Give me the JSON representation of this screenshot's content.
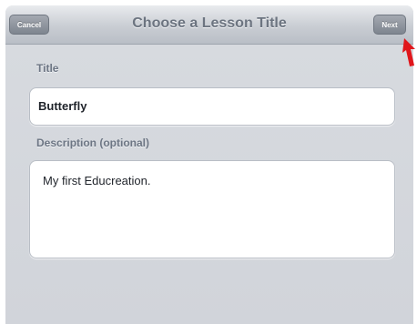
{
  "nav": {
    "title": "Choose a Lesson Title",
    "cancel_label": "Cancel",
    "next_label": "Next"
  },
  "form": {
    "title_label": "Title",
    "title_value": "Butterfly",
    "description_label": "Description (optional)",
    "description_value": "My first Educreation."
  },
  "colors": {
    "pointer_arrow": "#e0161b"
  },
  "icons": {
    "pointer": "red-arrow-icon"
  }
}
